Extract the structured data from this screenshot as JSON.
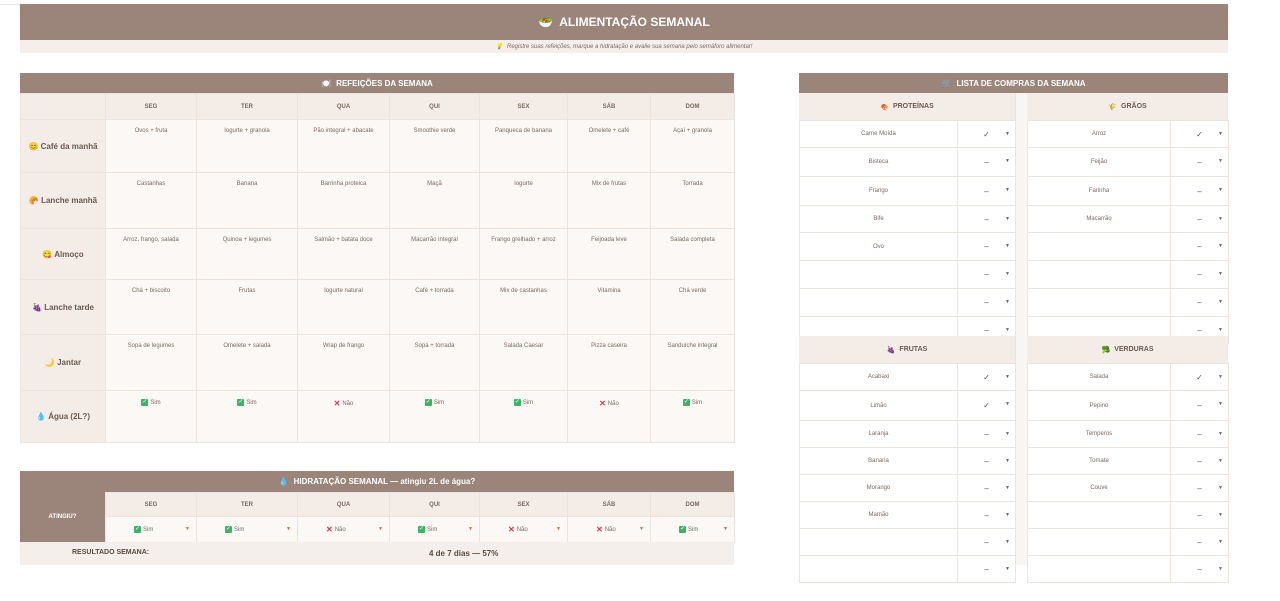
{
  "banner": {
    "icon": "🥗",
    "title": "ALIMENTAÇÃO SEMANAL"
  },
  "subnote": {
    "icon": "💡",
    "text": "Registre suas refeições, marque a hidratação e avalie sua semana pelo semáforo alimentar!"
  },
  "meals": {
    "header_icon": "🍽️",
    "header": "REFEIÇÕES DA SEMANA",
    "days": [
      "SEG",
      "TER",
      "QUA",
      "QUI",
      "SEX",
      "SÁB",
      "DOM"
    ],
    "rows": [
      {
        "icon": "😊",
        "label": "Café da manhã",
        "cells": [
          "Ovos + fruta",
          "Iogurte + granola",
          "Pão integral + abacate",
          "Smoothie verde",
          "Panqueca de banana",
          "Omelete + café",
          "Açaí + granola"
        ]
      },
      {
        "icon": "🥐",
        "label": "Lanche manhã",
        "cells": [
          "Castanhas",
          "Banana",
          "Barrinha proteica",
          "Maçã",
          "Iogurte",
          "Mix de frutas",
          "Torrada"
        ]
      },
      {
        "icon": "😋",
        "label": "Almoço",
        "cells": [
          "Arroz, frango, salada",
          "Quinoa + legumes",
          "Salmão + batata doce",
          "Macarrão integral",
          "Frango grelhado + arroz",
          "Feijoada leve",
          "Salada completa"
        ]
      },
      {
        "icon": "🍇",
        "label": "Lanche tarde",
        "cells": [
          "Chá + biscoito",
          "Frutas",
          "Iogurte natural",
          "Café + torrada",
          "Mix de castanhas",
          "Vitamina",
          "Chá verde"
        ]
      },
      {
        "icon": "🌙",
        "label": "Jantar",
        "cells": [
          "Sopa de legumes",
          "Omelete + salada",
          "Wrap de frango",
          "Sopa + torrada",
          "Salada Caesar",
          "Pizza caseira",
          "Sanduíche integral"
        ]
      }
    ],
    "water": {
      "icon": "💧",
      "label": "Água (2L?)",
      "values": [
        {
          "mark": "check",
          "text": "Sim"
        },
        {
          "mark": "check",
          "text": "Sim"
        },
        {
          "mark": "cross",
          "text": "Não"
        },
        {
          "mark": "check",
          "text": "Sim"
        },
        {
          "mark": "check",
          "text": "Sim"
        },
        {
          "mark": "cross",
          "text": "Não"
        },
        {
          "mark": "check",
          "text": "Sim"
        }
      ]
    }
  },
  "hydration": {
    "header_icon": "💧",
    "header": "HIDRATAÇÃO SEMANAL — atingiu 2L de água?",
    "row_label": "ATINGIU?",
    "days": [
      "SEG",
      "TER",
      "QUA",
      "QUI",
      "SEX",
      "SÁB",
      "DOM"
    ],
    "values": [
      {
        "mark": "check",
        "text": "Sim"
      },
      {
        "mark": "check",
        "text": "Sim"
      },
      {
        "mark": "cross",
        "text": "Não"
      },
      {
        "mark": "check",
        "text": "Sim"
      },
      {
        "mark": "cross",
        "text": "Não"
      },
      {
        "mark": "cross",
        "text": "Não"
      },
      {
        "mark": "check",
        "text": "Sim"
      }
    ],
    "dropdown_glyph": "▼",
    "result_label": "RESULTADO SEMANA:",
    "result_value": "4 de 7 dias — 57%"
  },
  "shopping": {
    "header_icon": "🛒",
    "header": "LISTA DE COMPRAS DA SEMANA",
    "dropdown_glyph": "▼",
    "top": {
      "left": {
        "icon": "🍖",
        "title": "PROTEÍNAS",
        "items": [
          {
            "name": "Carne Moída",
            "status": "✓"
          },
          {
            "name": "Bisteca",
            "status": "–"
          },
          {
            "name": "Frango",
            "status": "–"
          },
          {
            "name": "Bife",
            "status": "–"
          },
          {
            "name": "Ovo",
            "status": "–"
          },
          {
            "name": "",
            "status": "–"
          },
          {
            "name": "",
            "status": "–"
          },
          {
            "name": "",
            "status": "–"
          }
        ]
      },
      "right": {
        "icon": "🌾",
        "title": "GRÃOS",
        "items": [
          {
            "name": "Arroz",
            "status": "✓"
          },
          {
            "name": "Feijão",
            "status": "–"
          },
          {
            "name": "Farinha",
            "status": "–"
          },
          {
            "name": "Macarrão",
            "status": "–"
          },
          {
            "name": "",
            "status": "–"
          },
          {
            "name": "",
            "status": "–"
          },
          {
            "name": "",
            "status": "–"
          },
          {
            "name": "",
            "status": "–"
          }
        ]
      }
    },
    "bottom": {
      "left": {
        "icon": "🍇",
        "title": "FRUTAS",
        "items": [
          {
            "name": "Acabaxi",
            "status": "✓"
          },
          {
            "name": "Limão",
            "status": "✓"
          },
          {
            "name": "Laranja",
            "status": "–"
          },
          {
            "name": "Banana",
            "status": "–"
          },
          {
            "name": "Morango",
            "status": "–"
          },
          {
            "name": "Mamão",
            "status": "–"
          },
          {
            "name": "",
            "status": "–"
          },
          {
            "name": "",
            "status": "–"
          }
        ]
      },
      "right": {
        "icon": "🥦",
        "title": "VERDURAS",
        "items": [
          {
            "name": "Salada",
            "status": "✓"
          },
          {
            "name": "Pepino",
            "status": "–"
          },
          {
            "name": "Temperos",
            "status": "–"
          },
          {
            "name": "Tomate",
            "status": "–"
          },
          {
            "name": "Couve",
            "status": "–"
          },
          {
            "name": "",
            "status": "–"
          },
          {
            "name": "",
            "status": "–"
          },
          {
            "name": "",
            "status": "–"
          }
        ]
      }
    }
  },
  "colors": {
    "header_bg": "#9b857b",
    "check_green": "#3cb464",
    "cross_red": "#e0344b"
  }
}
